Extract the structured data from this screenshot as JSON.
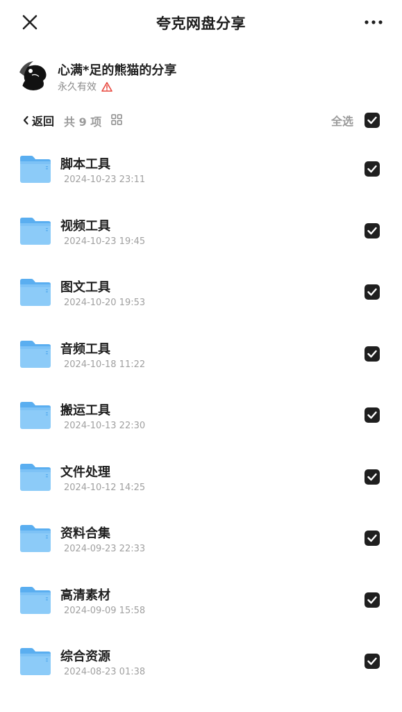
{
  "header": {
    "title": "夸克网盘分享",
    "close_icon": "close-icon",
    "more_icon": "more-dots-icon"
  },
  "sharer": {
    "name": "心满*足的熊猫的分享",
    "validity": "永久有效",
    "warning_icon": "warning-triangle-icon"
  },
  "toolbar": {
    "back_label": "返回",
    "total": "共 9 项",
    "grid_icon": "grid-view-icon",
    "select_all_label": "全选",
    "select_all_checked": true
  },
  "files": [
    {
      "name": "脚本工具",
      "time": "2024-10-23 23:11",
      "checked": true
    },
    {
      "name": "视频工具",
      "time": "2024-10-23 19:45",
      "checked": true
    },
    {
      "name": "图文工具",
      "time": "2024-10-20 19:53",
      "checked": true
    },
    {
      "name": "音频工具",
      "time": "2024-10-18 11:22",
      "checked": true
    },
    {
      "name": "搬运工具",
      "time": "2024-10-13 22:30",
      "checked": true
    },
    {
      "name": "文件处理",
      "time": "2024-10-12 14:25",
      "checked": true
    },
    {
      "name": "资料合集",
      "time": "2024-09-23 22:33",
      "checked": true
    },
    {
      "name": "高清素材",
      "time": "2024-09-09 15:58",
      "checked": true
    },
    {
      "name": "综合资源",
      "time": "2024-08-23 01:38",
      "checked": true
    }
  ],
  "colors": {
    "checkbox": "#1f1f1f",
    "folder_top": "#5aaef0",
    "folder_body": "#8ccbf8",
    "warning": "#e8483f",
    "secondary_text": "#9a9a9a"
  }
}
